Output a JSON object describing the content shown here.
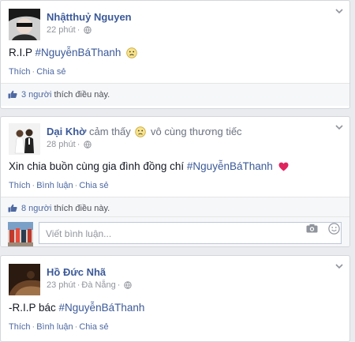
{
  "posts": [
    {
      "author": "Nhậtthuỷ Nguyen",
      "time": "22 phút",
      "text_prefix": "R.I.P ",
      "hashtag": "#NguyễnBáThanh",
      "actions": {
        "like": "Thích",
        "share": "Chia sẻ"
      },
      "likes": {
        "count": "3 người",
        "suffix": " thích điều này."
      }
    },
    {
      "author": "Dại Khờ",
      "feeling_prefix": "cảm thấy",
      "feeling": "vô cùng thương tiếc",
      "time": "28 phút",
      "text_prefix": "Xin chia buồn cùng gia đình đồng chí ",
      "hashtag": "#NguyễnBáThanh",
      "actions": {
        "like": "Thích",
        "comment": "Bình luận",
        "share": "Chia sẻ"
      },
      "likes": {
        "count": "8 người",
        "suffix": " thích điều này."
      },
      "comment_placeholder": "Viết bình luận..."
    },
    {
      "author": "Hồ Đức Nhã",
      "time": "23 phút",
      "location": "Đà Nẵng",
      "text_prefix": "-R.I.P bác ",
      "hashtag": "#NguyễnBáThanh",
      "actions": {
        "like": "Thích",
        "comment": "Bình luận",
        "share": "Chia sẻ"
      }
    }
  ],
  "colors": {
    "link": "#3b5998",
    "heart": "#e0245e",
    "background": "#e9ebee"
  },
  "icons": [
    "chevron-down-icon",
    "globe-icon",
    "frown-emoji-icon",
    "smile-emoji-icon",
    "heart-icon",
    "thumbs-up-icon",
    "camera-icon",
    "emoji-icon"
  ]
}
